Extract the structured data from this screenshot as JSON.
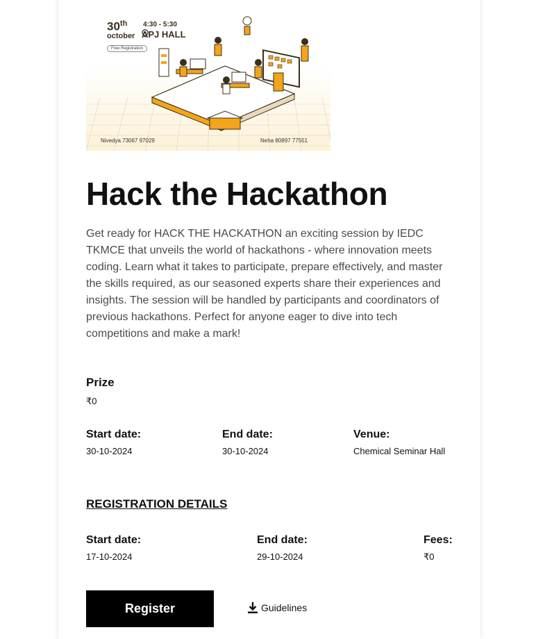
{
  "poster": {
    "day": "30",
    "day_suffix": "th",
    "month": "october",
    "time": "4:30 - 5:30",
    "venue": "APJ HALL",
    "badge": "Free Registration",
    "contact_1": "Nivedya 73067 97029",
    "contact_2": "Neha 80897 77551",
    "accent_color": "#f2a51a"
  },
  "event": {
    "title": "Hack the Hackathon",
    "description": "Get ready for HACK THE HACKATHON an exciting session by IEDC TKMCE that unveils the world of hackathons - where innovation meets coding. Learn what it takes to participate, prepare effectively, and master the skills required, as our seasoned experts share their experiences and insights. The session will be handled by participants and coordinators of previous hackathons. Perfect for anyone eager to dive into tech competitions and make a mark!",
    "prize_label": "Prize",
    "prize_value": "₹0",
    "start_label": "Start date:",
    "start_value": "30-10-2024",
    "end_label": "End date:",
    "end_value": "30-10-2024",
    "venue_label": "Venue:",
    "venue_value": "Chemical Seminar Hall"
  },
  "registration": {
    "heading": "REGISTRATION DETAILS",
    "start_label": "Start date:",
    "start_value": "17-10-2024",
    "end_label": "End date:",
    "end_value": "29-10-2024",
    "fees_label": "Fees:",
    "fees_value": "₹0"
  },
  "actions": {
    "register_label": "Register",
    "guidelines_label": "Guidelines",
    "guidelines_icon": "download-icon"
  }
}
